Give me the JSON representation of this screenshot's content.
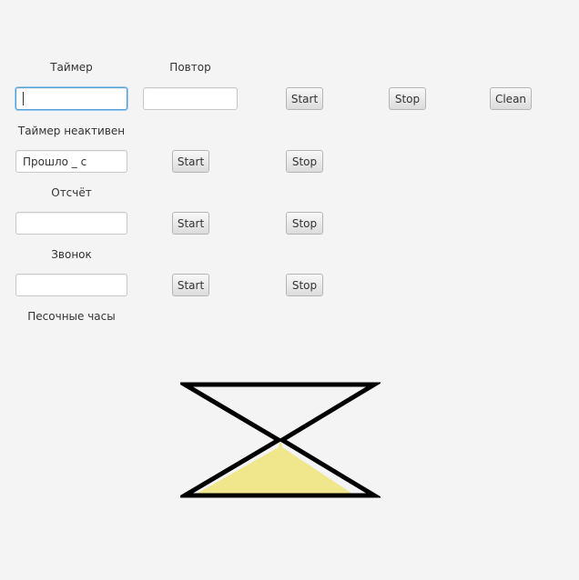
{
  "timer": {
    "label": "Таймер",
    "repeat_label": "Повтор",
    "value": "",
    "repeat_value": "",
    "start_label": "Start",
    "stop_label": "Stop",
    "clean_label": "Clean",
    "status": "Таймер неактивен"
  },
  "elapsed": {
    "value": "Прошло _ с",
    "start_label": "Start",
    "stop_label": "Stop"
  },
  "countdown": {
    "label": "Отсчёт",
    "value": "",
    "start_label": "Start",
    "stop_label": "Stop"
  },
  "alarm": {
    "label": "Звонок",
    "value": "",
    "start_label": "Start",
    "stop_label": "Stop"
  },
  "hourglass": {
    "label": "Песочные часы",
    "sand_color": "#f0e68c",
    "frame_color": "#000000"
  }
}
